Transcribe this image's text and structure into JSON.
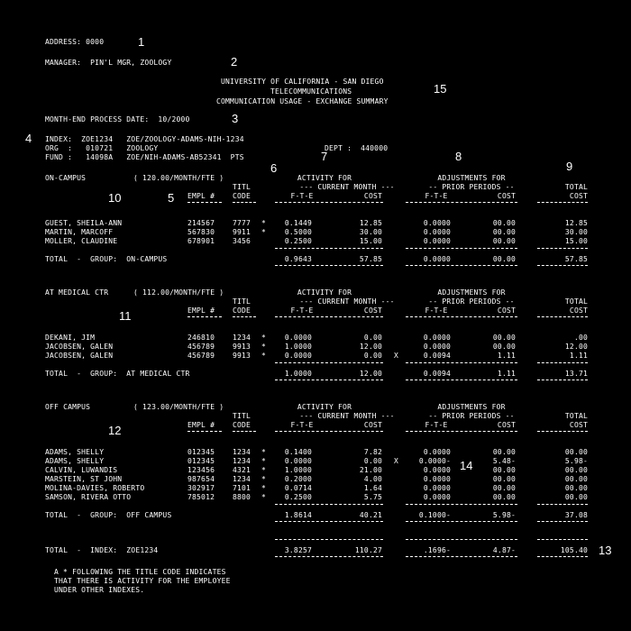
{
  "header": {
    "address": "ADDRESS: 0000",
    "manager": "MANAGER:  PIN'L MGR, ZOOLOGY",
    "title1": "UNIVERSITY OF CALIFORNIA - SAN DIEGO",
    "title2": "TELECOMMUNICATIONS",
    "title3": "COMMUNICATION USAGE - EXCHANGE SUMMARY",
    "process_date": "MONTH-END PROCESS DATE:  10/2000",
    "index_line": "INDEX:  ZOE1234   ZOE/ZOOLOGY-ADAMS-NIH-1234",
    "org_line": "ORG  :   010721   ZOOLOGY",
    "dept_line": "DEPT :  440000",
    "fund_line": "FUND :   14098A   ZOE/NIH-ADAMS-AB52341  PTS"
  },
  "markers": [
    "1",
    "2",
    "3",
    "4",
    "5",
    "6",
    "7",
    "8",
    "9",
    "10",
    "11",
    "12",
    "13",
    "14",
    "15"
  ],
  "col_headers": {
    "activity": "ACTIVITY FOR",
    "adjustments": "ADJUSTMENTS FOR",
    "total": "TOTAL",
    "title": "TITL",
    "current_month": "--- CURRENT MONTH ---",
    "prior_periods": "-- PRIOR PERIODS --",
    "empl": "EMPL #",
    "code": "CODE",
    "fte": "F-T-E",
    "cost": "COST"
  },
  "groups": [
    {
      "name": "ON-CAMPUS",
      "rate": "( 120.00/MONTH/FTE )",
      "rows": [
        {
          "name": "GUEST, SHEILA-ANN",
          "empl": "214567",
          "code": "7777",
          "star": "*",
          "fte": "0.1449",
          "cost": "12.85",
          "adj_fte": "0.0000",
          "adj_cost": "00.00",
          "total": "12.85"
        },
        {
          "name": "MARTIN, MARCOFF",
          "empl": "567830",
          "code": "9911",
          "star": "*",
          "fte": "0.5000",
          "cost": "30.00",
          "adj_fte": "0.0000",
          "adj_cost": "00.00",
          "total": "30.00"
        },
        {
          "name": "MOLLER, CLAUDINE",
          "empl": "678901",
          "code": "3456",
          "star": "",
          "fte": "0.2500",
          "cost": "15.00",
          "adj_fte": "0.0000",
          "adj_cost": "00.00",
          "total": "15.00"
        }
      ],
      "total_label": "TOTAL  -  GROUP:  ON-CAMPUS",
      "total": {
        "fte": "0.9643",
        "cost": "57.85",
        "adj_fte": "0.0000",
        "adj_cost": "00.00",
        "total": "57.85"
      }
    },
    {
      "name": "AT MEDICAL CTR",
      "rate": "( 112.00/MONTH/FTE )",
      "rows": [
        {
          "name": "DEKANI, JIM",
          "empl": "246810",
          "code": "1234",
          "star": "*",
          "fte": "0.0000",
          "cost": "0.00",
          "adj_fte": "0.0000",
          "adj_cost": "00.00",
          "total": ".00"
        },
        {
          "name": "JACOBSEN, GALEN",
          "empl": "456789",
          "code": "9913",
          "star": "*",
          "fte": "1.0000",
          "cost": "12.00",
          "adj_fte": "0.0000",
          "adj_cost": "00.00",
          "total": "12.00"
        },
        {
          "name": "JACOBSEN, GALEN",
          "empl": "456789",
          "code": "9913",
          "star": "*",
          "fte": "0.0000",
          "cost": "0.00",
          "x": "X",
          "adj_fte": "0.0094",
          "adj_cost": "1.11",
          "total": "1.11"
        }
      ],
      "total_label": "TOTAL  -  GROUP:  AT MEDICAL CTR",
      "total": {
        "fte": "1.0000",
        "cost": "12.00",
        "adj_fte": "0.0094",
        "adj_cost": "1.11",
        "total": "13.71"
      }
    },
    {
      "name": "OFF CAMPUS",
      "rate": "( 123.00/MONTH/FTE )",
      "rows": [
        {
          "name": "ADAMS, SHELLY",
          "empl": "012345",
          "code": "1234",
          "star": "*",
          "fte": "0.1400",
          "cost": "7.82",
          "adj_fte": "0.0000",
          "adj_cost": "00.00",
          "total": "00.00"
        },
        {
          "name": "ADAMS, SHELLY",
          "empl": "012345",
          "code": "1234",
          "star": "*",
          "fte": "0.0000",
          "cost": "0.00",
          "x": "X",
          "adj_fte": "0.0000-",
          "adj_cost": "5.48-",
          "total": "5.98-"
        },
        {
          "name": "CALVIN, LUWANDIS",
          "empl": "123456",
          "code": "4321",
          "star": "*",
          "fte": "1.0000",
          "cost": "21.00",
          "adj_fte": "0.0000",
          "adj_cost": "00.00",
          "total": "00.00"
        },
        {
          "name": "MARSTEIN, ST JOHN",
          "empl": "987654",
          "code": "1234",
          "star": "*",
          "fte": "0.2000",
          "cost": "4.00",
          "adj_fte": "0.0000",
          "adj_cost": "00.00",
          "total": "00.00"
        },
        {
          "name": "MOLINA-DAVIES, ROBERTO",
          "empl": "302917",
          "code": "7101",
          "star": "*",
          "fte": "0.0714",
          "cost": "1.64",
          "adj_fte": "0.0000",
          "adj_cost": "00.00",
          "total": "00.00"
        },
        {
          "name": "SAMSON, RIVERA OTTO",
          "empl": "785012",
          "code": "8800",
          "star": "*",
          "fte": "0.2500",
          "cost": "5.75",
          "adj_fte": "0.0000",
          "adj_cost": "00.00",
          "total": "00.00"
        }
      ],
      "total_label": "TOTAL  -  GROUP:  OFF CAMPUS",
      "total": {
        "fte": "1.8614",
        "cost": "40.21",
        "adj_fte": "0.1000-",
        "adj_cost": "5.98-",
        "total": "37.08"
      }
    }
  ],
  "index_total": {
    "label": "TOTAL  -  INDEX:  ZOE1234",
    "fte": "3.8257",
    "cost": "110.27",
    "adj_fte": ".1696-",
    "adj_cost": "4.87-",
    "total": "105.40"
  },
  "footnote": [
    "A * FOLLOWING THE TITLE CODE INDICATES",
    "THAT THERE IS ACTIVITY FOR THE EMPLOYEE",
    "UNDER OTHER INDEXES."
  ]
}
